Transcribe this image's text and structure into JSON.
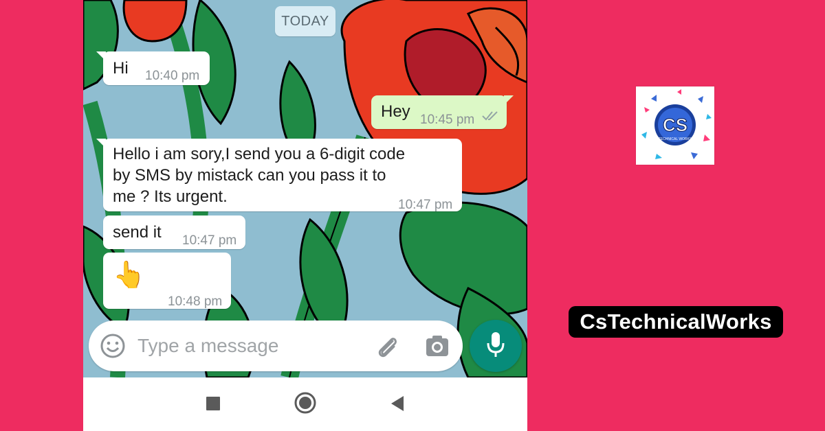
{
  "chat": {
    "date_chip": "TODAY",
    "messages": [
      {
        "direction": "incoming",
        "text": "Hi",
        "time": "10:40 pm"
      },
      {
        "direction": "outgoing",
        "text": "Hey",
        "time": "10:45 pm",
        "status": "read"
      },
      {
        "direction": "incoming",
        "lines": [
          "Hello i am sory,I send you a 6-digit code",
          "by SMS by mistack can you pass it to",
          "me ? Its urgent."
        ],
        "time": "10:47 pm"
      },
      {
        "direction": "incoming",
        "text": "send it",
        "time": "10:47 pm"
      },
      {
        "direction": "incoming",
        "text": "👆",
        "time": "10:48 pm"
      }
    ]
  },
  "composer": {
    "placeholder": "Type a message",
    "icons": [
      "emoji-icon",
      "attach-icon",
      "camera-icon",
      "mic-icon"
    ]
  },
  "navbar": {
    "icons": [
      "recents-icon",
      "home-icon",
      "back-icon"
    ]
  },
  "brand": {
    "name": "CsTechnicalWorks",
    "logo_initials": "CS",
    "logo_caption": "TECHNICAL WORKS"
  },
  "colors": {
    "background": "#ee2c60",
    "incoming_bubble": "#ffffff",
    "outgoing_bubble": "#dcf8c6",
    "mic_button": "#078c7a"
  }
}
